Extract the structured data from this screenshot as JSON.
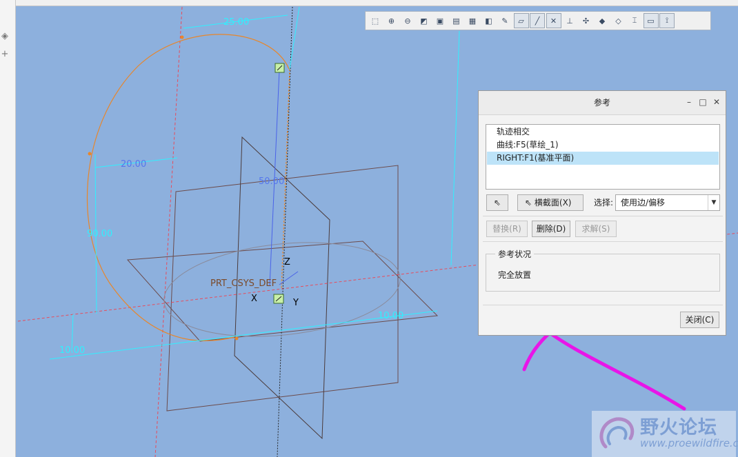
{
  "toolbar": {
    "buttons": [
      {
        "icon": "zoom-box-icon"
      },
      {
        "icon": "zoom-in-icon"
      },
      {
        "icon": "zoom-out-icon"
      },
      {
        "icon": "refit-icon"
      },
      {
        "icon": "view-orientation-icon"
      },
      {
        "icon": "saved-views-icon"
      },
      {
        "icon": "display-style-icon"
      },
      {
        "icon": "section-view-icon"
      },
      {
        "icon": "annotation-display-icon"
      },
      {
        "icon": "plane-display-icon",
        "active": true
      },
      {
        "icon": "axis-display-icon",
        "active": true
      },
      {
        "icon": "point-display-icon",
        "active": true
      },
      {
        "icon": "csys-display-icon"
      },
      {
        "icon": "spin-center-icon"
      },
      {
        "icon": "shading-icon"
      },
      {
        "icon": "shading-edges-icon"
      },
      {
        "icon": "dimension-display-icon"
      },
      {
        "icon": "constraint-display-icon",
        "active": true
      },
      {
        "icon": "vertex-display-icon",
        "active": true
      }
    ]
  },
  "viewport": {
    "dimensions": [
      "25.00",
      "20.00",
      "50.00",
      "90.00",
      "10.00",
      "10.00"
    ],
    "csys_label": "PRT_CSYS_DEF",
    "axis_labels": {
      "x": "X",
      "y": "Y",
      "z": "Z"
    }
  },
  "dialog": {
    "title": "参考",
    "references": [
      {
        "label": "轨迹相交",
        "selected": false
      },
      {
        "label": "曲线:F5(草绘_1)",
        "selected": false
      },
      {
        "label": "RIGHT:F1(基准平面)",
        "selected": true
      }
    ],
    "section_button": "横截面(X)",
    "select_label": "选择:",
    "select_value": "使用边/偏移",
    "replace_button": "替换(R)",
    "delete_button": "删除(D)",
    "solve_button": "求解(S)",
    "status_legend": "参考状况",
    "status_text": "完全放置",
    "close_button": "关闭(C)"
  },
  "watermark": {
    "title": "野火论坛",
    "url": "www.proewildfire.cn"
  },
  "colors": {
    "viewport_bg": "#8db0dd",
    "sketch_orange": "#e8862a",
    "dimension_cyan": "#2ff0ff",
    "annotation_magenta": "#e815e8",
    "selection_blue": "#bde3f8"
  }
}
